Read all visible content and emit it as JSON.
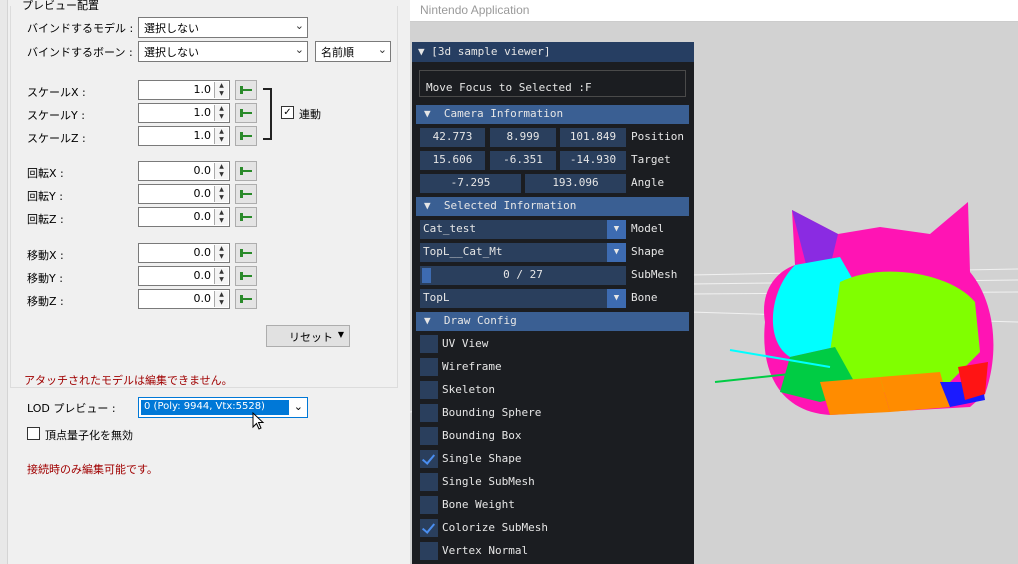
{
  "left_panel": {
    "group_title": "プレビュー配置",
    "bind_model_label": "バインドするモデル :",
    "bind_model_value": "選択しない",
    "bind_bone_label": "バインドするボーン :",
    "bind_bone_value": "選択しない",
    "sort_value": "名前順",
    "scale": [
      {
        "label": "スケールX :",
        "value": "1.0"
      },
      {
        "label": "スケールY :",
        "value": "1.0"
      },
      {
        "label": "スケールZ :",
        "value": "1.0"
      }
    ],
    "link_label": "連動",
    "link_checked": true,
    "rotate": [
      {
        "label": "回転X :",
        "value": "0.0"
      },
      {
        "label": "回転Y :",
        "value": "0.0"
      },
      {
        "label": "回転Z :",
        "value": "0.0"
      }
    ],
    "translate": [
      {
        "label": "移動X :",
        "value": "0.0"
      },
      {
        "label": "移動Y :",
        "value": "0.0"
      },
      {
        "label": "移動Z :",
        "value": "0.0"
      }
    ],
    "reset_label": "リセット",
    "attached_note": "アタッチされたモデルは編集できません。",
    "lod_label": "LOD プレビュー :",
    "lod_value": "0 (Poly: 9944, Vtx:5528)",
    "quantize_label": "頂点量子化を無効",
    "connected_note": "接続時のみ編集可能です。"
  },
  "app": {
    "title": "Nintendo Application"
  },
  "viewer": {
    "title": "[3d sample viewer]",
    "focus_text": "Move Focus to Selected :F",
    "camera_header": "Camera Information",
    "position": [
      "42.773",
      "8.999",
      "101.849"
    ],
    "position_label": "Position",
    "target": [
      "15.606",
      "-6.351",
      "-14.930"
    ],
    "target_label": "Target",
    "angle": [
      "-7.295",
      "193.096"
    ],
    "angle_label": "Angle",
    "selected_header": "Selected Information",
    "model_value": "Cat_test",
    "model_label": "Model",
    "shape_value": "TopL__Cat_Mt",
    "shape_label": "Shape",
    "submesh_value": "0 / 27",
    "submesh_label": "SubMesh",
    "bone_value": "TopL",
    "bone_label": "Bone",
    "draw_header": "Draw Config",
    "draw_items": [
      {
        "label": "UV View",
        "checked": false
      },
      {
        "label": "Wireframe",
        "checked": false
      },
      {
        "label": "Skeleton",
        "checked": false
      },
      {
        "label": "Bounding Sphere",
        "checked": false
      },
      {
        "label": "Bounding Box",
        "checked": false
      },
      {
        "label": "Single Shape",
        "checked": true
      },
      {
        "label": "Single SubMesh",
        "checked": false
      },
      {
        "label": "Bone Weight",
        "checked": false
      },
      {
        "label": "Colorize SubMesh",
        "checked": true
      },
      {
        "label": "Vertex Normal",
        "checked": false
      }
    ]
  }
}
